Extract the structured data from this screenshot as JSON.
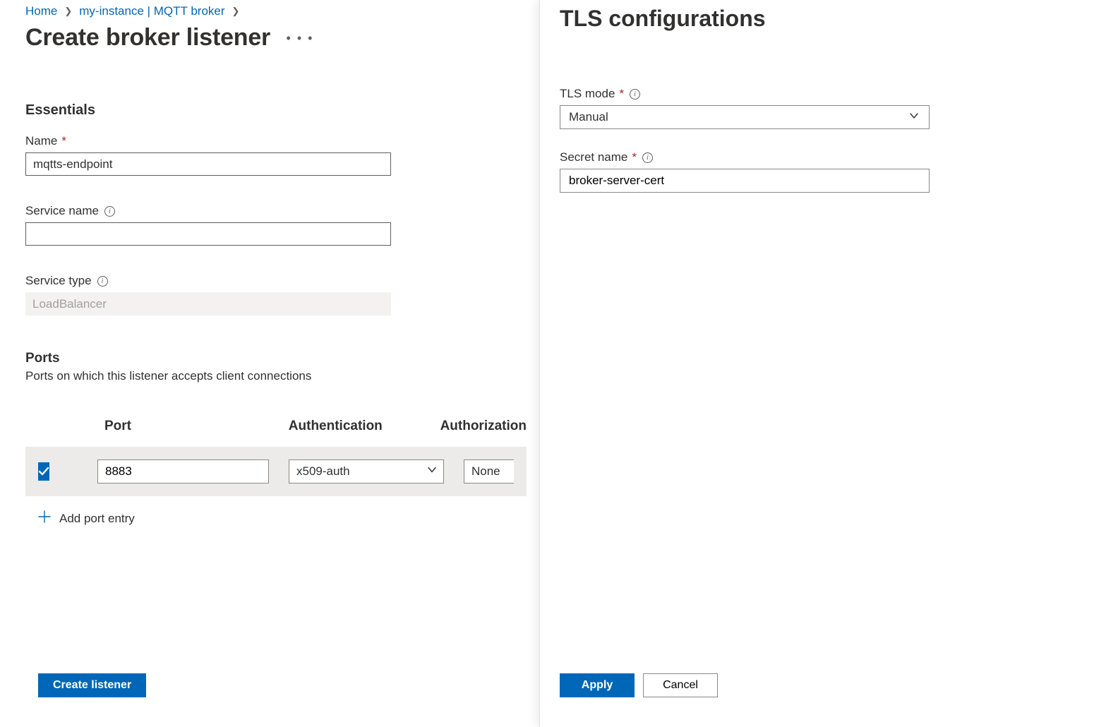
{
  "breadcrumb": {
    "home": "Home",
    "instance": "my-instance | MQTT broker"
  },
  "page_title": "Create broker listener",
  "essentials": {
    "heading": "Essentials",
    "name_label": "Name",
    "name_value": "mqtts-endpoint",
    "service_name_label": "Service name",
    "service_name_value": "",
    "service_type_label": "Service type",
    "service_type_value": "LoadBalancer"
  },
  "ports": {
    "heading": "Ports",
    "description": "Ports on which this listener accepts client connections",
    "columns": {
      "port": "Port",
      "auth": "Authentication",
      "authz": "Authorization"
    },
    "rows": [
      {
        "port": "8883",
        "auth": "x509-auth",
        "authz": "None"
      }
    ],
    "add_label": "Add port entry"
  },
  "footer": {
    "create": "Create listener"
  },
  "side_panel": {
    "title": "TLS configurations",
    "tls_mode_label": "TLS mode",
    "tls_mode_value": "Manual",
    "secret_name_label": "Secret name",
    "secret_name_value": "broker-server-cert",
    "apply": "Apply",
    "cancel": "Cancel"
  }
}
